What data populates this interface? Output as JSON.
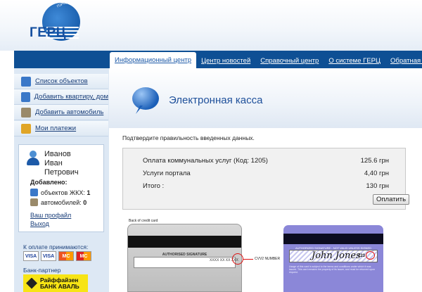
{
  "logo": {
    "text": "ГЕРЦ",
    "arc_text": "ГОРОДСКОЙ ЕДИНЫЙ РАСЧЕТНЫЙ ЦЕНТР"
  },
  "nav": [
    {
      "label": "Информационный центр",
      "active": true
    },
    {
      "label": "Центр новостей"
    },
    {
      "label": "Справочный центр"
    },
    {
      "label": "О системе ГЕРЦ"
    },
    {
      "label": "Обратная связь"
    }
  ],
  "sidebar": {
    "items": [
      {
        "label": "Список объектов",
        "icon": "list-icon"
      },
      {
        "label": "Добавить квартиру, дом",
        "icon": "house-icon"
      },
      {
        "label": "Добавить автомобиль",
        "icon": "car-icon"
      },
      {
        "label": "Мои платежи",
        "icon": "coins-icon"
      }
    ],
    "user": {
      "name_line1": "Иванов",
      "name_line2": "Иван",
      "name_line3": "Петрович",
      "added_label": "Добавлено:",
      "objects_label": "объектов ЖКХ:",
      "objects_count": "1",
      "cars_label": "автомобилей:",
      "cars_count": "0",
      "profile_link": "Ваш профайл",
      "logout_link": "Выход"
    },
    "payment_label": "К оплате принимаются:",
    "cards": [
      "VISA",
      "VISA",
      "MC",
      "MC"
    ],
    "bank_label": "Банк-партнер",
    "bank_name_line1": "Райффайзен",
    "bank_name_line2": "БАНК АВАЛЬ"
  },
  "main": {
    "title": "Электронная касса",
    "confirm_text": "Подтвердите правильность введенных данных.",
    "rows": [
      {
        "label": "Оплата коммунальных услуг (Код: 1205)",
        "amount": "125.6 грн"
      },
      {
        "label": "Услуги портала",
        "amount": "4,40 грн"
      },
      {
        "label": "Итого :",
        "amount": "130 грн"
      }
    ],
    "pay_button": "Оплатить"
  },
  "card_help": {
    "back_label": "Back of credit card",
    "signature_label": "AUTHORISED SIGNATURE",
    "card_number": "XXXX XX XX XXX",
    "cvv_label": "CVV2 NUMBER",
    "sample_auth": "AUTHORIZED SIGNATURE - NOT VALID UNLESS SIGNED",
    "sample_signature": "John Jones",
    "sample_code": "123",
    "sample_cvv": "456",
    "fine_print": "Usage of this card is subject to the terms and conditions under which it was issued. This card remains the property of its issuer, and must be returned upon request."
  },
  "colors": {
    "nav_bg": "#0e4f94",
    "sidebar_bg": "#dde8f4",
    "title": "#1d4f9a",
    "bank_yellow": "#f7e415"
  }
}
